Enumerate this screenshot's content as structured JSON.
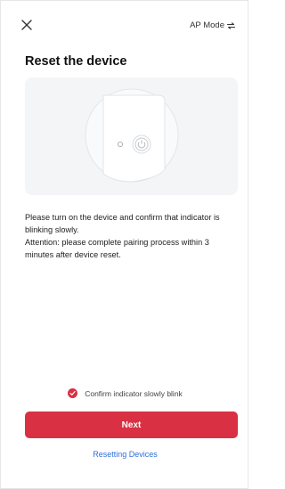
{
  "header": {
    "close_icon": "close-icon",
    "mode_label": "AP Mode",
    "mode_icon": "switch-arrows-icon"
  },
  "page": {
    "title": "Reset the device"
  },
  "instructions": {
    "line1": "Please turn on the device and confirm that indicator is blinking slowly.",
    "line2": "Attention: please complete pairing process within 3 minutes after device reset."
  },
  "confirm": {
    "label": "Confirm indicator slowly blink",
    "checked": true
  },
  "actions": {
    "next_label": "Next",
    "resetting_link": "Resetting Devices"
  },
  "colors": {
    "accent": "#d93043",
    "link": "#2e6fd9",
    "panel_bg": "#f4f5f7"
  }
}
